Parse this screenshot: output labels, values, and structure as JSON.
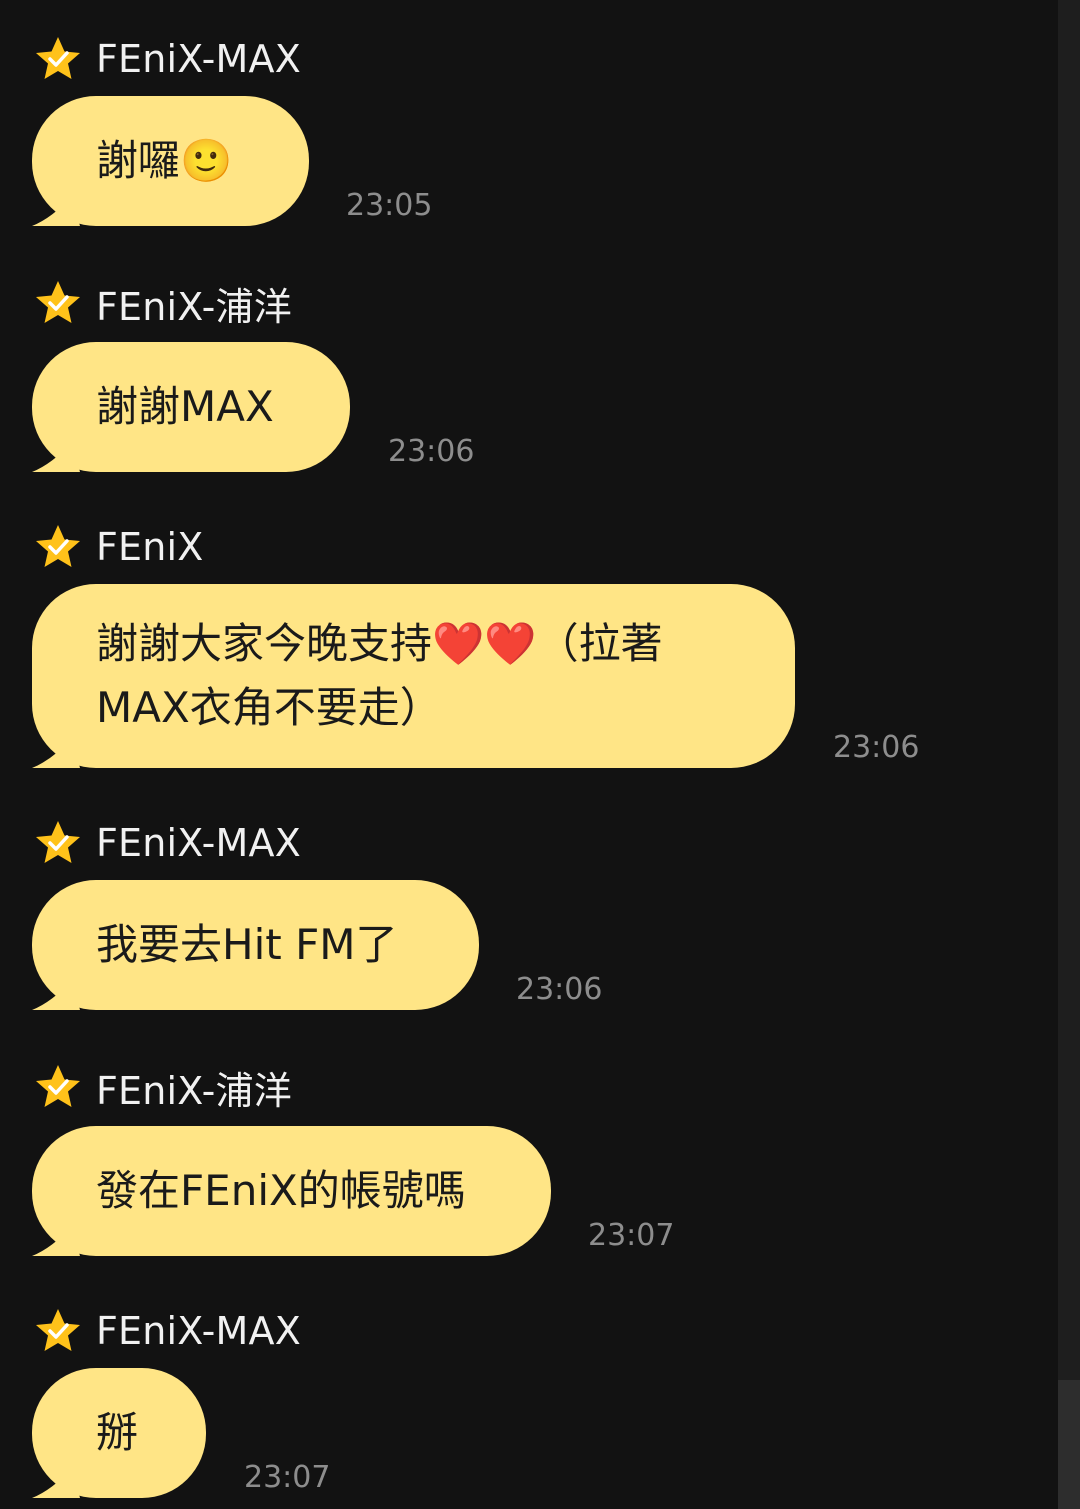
{
  "messages": [
    {
      "sender": "FEniX-MAX",
      "text": "謝囉🙂",
      "time": "23:05"
    },
    {
      "sender": "FEniX-浦洋",
      "text": "謝謝MAX",
      "time": "23:06"
    },
    {
      "sender": "FEniX",
      "text": "謝謝大家今晚支持❤️❤️（拉著\nMAX衣角不要走）",
      "time": "23:06"
    },
    {
      "sender": "FEniX-MAX",
      "text": "我要去Hit FM了",
      "time": "23:06"
    },
    {
      "sender": "FEniX-浦洋",
      "text": "發在FEniX的帳號嗎",
      "time": "23:07"
    },
    {
      "sender": "FEniX-MAX",
      "text": "掰",
      "time": "23:07"
    }
  ],
  "icons": {
    "sender_badge": "star-check-icon"
  },
  "colors": {
    "background": "#121212",
    "bubble": "#ffe586",
    "star": "#ffc21a",
    "timestamp": "#8d8d8d"
  }
}
